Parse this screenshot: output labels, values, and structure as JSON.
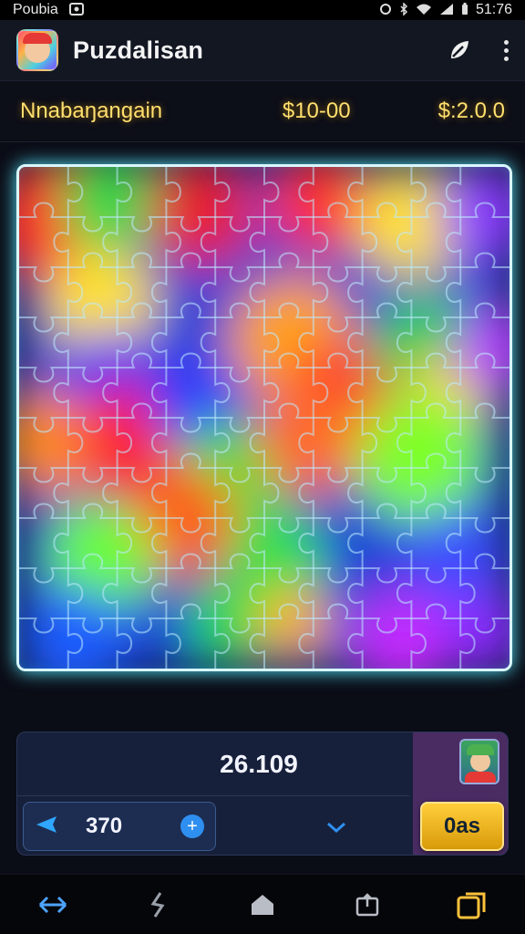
{
  "status": {
    "carrier": "Poubia",
    "time": "51:76"
  },
  "app": {
    "title": "Puzdalisan"
  },
  "info": {
    "label": "Nnabaŋangain",
    "value1": "$10-00",
    "value2": "$:2.0.0"
  },
  "puzzle": {
    "rows": 10,
    "cols": 10
  },
  "panel": {
    "score": "26.109",
    "count": "370",
    "go_label": "0as"
  },
  "colors": {
    "accent": "#58e7ff",
    "gold": "#ffcf3a",
    "panel": "#17203a"
  },
  "icons": {
    "status": [
      "image-icon",
      "alarm-icon",
      "bluetooth-icon",
      "wifi-icon",
      "signal-icon",
      "battery-icon"
    ],
    "appbar": [
      "leaf-icon",
      "more-vert-icon"
    ],
    "nav": [
      "back-arrow-icon",
      "hook-icon",
      "home-icon",
      "share-icon",
      "recent-apps-icon"
    ]
  }
}
